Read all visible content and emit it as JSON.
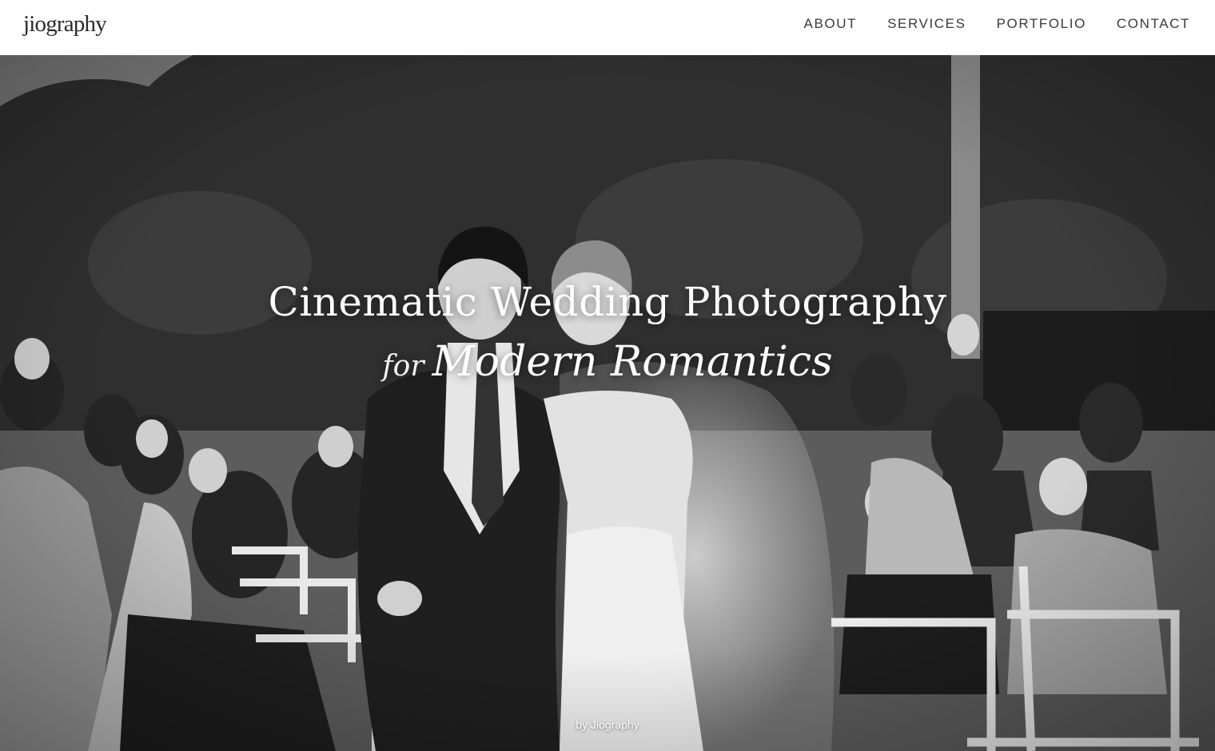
{
  "header": {
    "logo": "jiography",
    "nav": [
      {
        "label": "ABOUT"
      },
      {
        "label": "SERVICES"
      },
      {
        "label": "PORTFOLIO"
      },
      {
        "label": "CONTACT"
      }
    ]
  },
  "hero": {
    "headline_line1": "Cinematic Wedding Photography",
    "headline_for": "for",
    "headline_emphasis": "Modern Romantics",
    "byline": "by Jiography",
    "image_style": "black-and-white wedding ceremony photo"
  }
}
